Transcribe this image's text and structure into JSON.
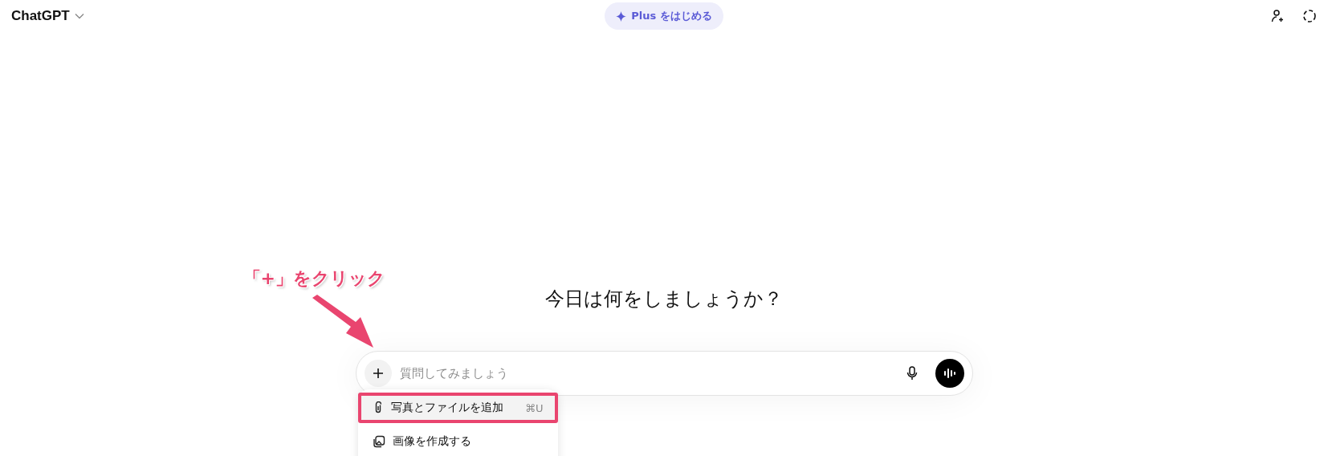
{
  "header": {
    "model_name": "ChatGPT",
    "upgrade_button": "Plus をはじめる"
  },
  "heading": "今日は何をしましょうか？",
  "annotation": {
    "text": "「+」をクリック"
  },
  "composer": {
    "placeholder": "質問してみましょう"
  },
  "attach_menu": {
    "items": [
      {
        "kind": "attach",
        "label": "写真とファイルを追加",
        "shortcut": "⌘U",
        "selected": true
      },
      {
        "kind": "image",
        "label": "画像を作成する",
        "selected": false
      }
    ]
  }
}
